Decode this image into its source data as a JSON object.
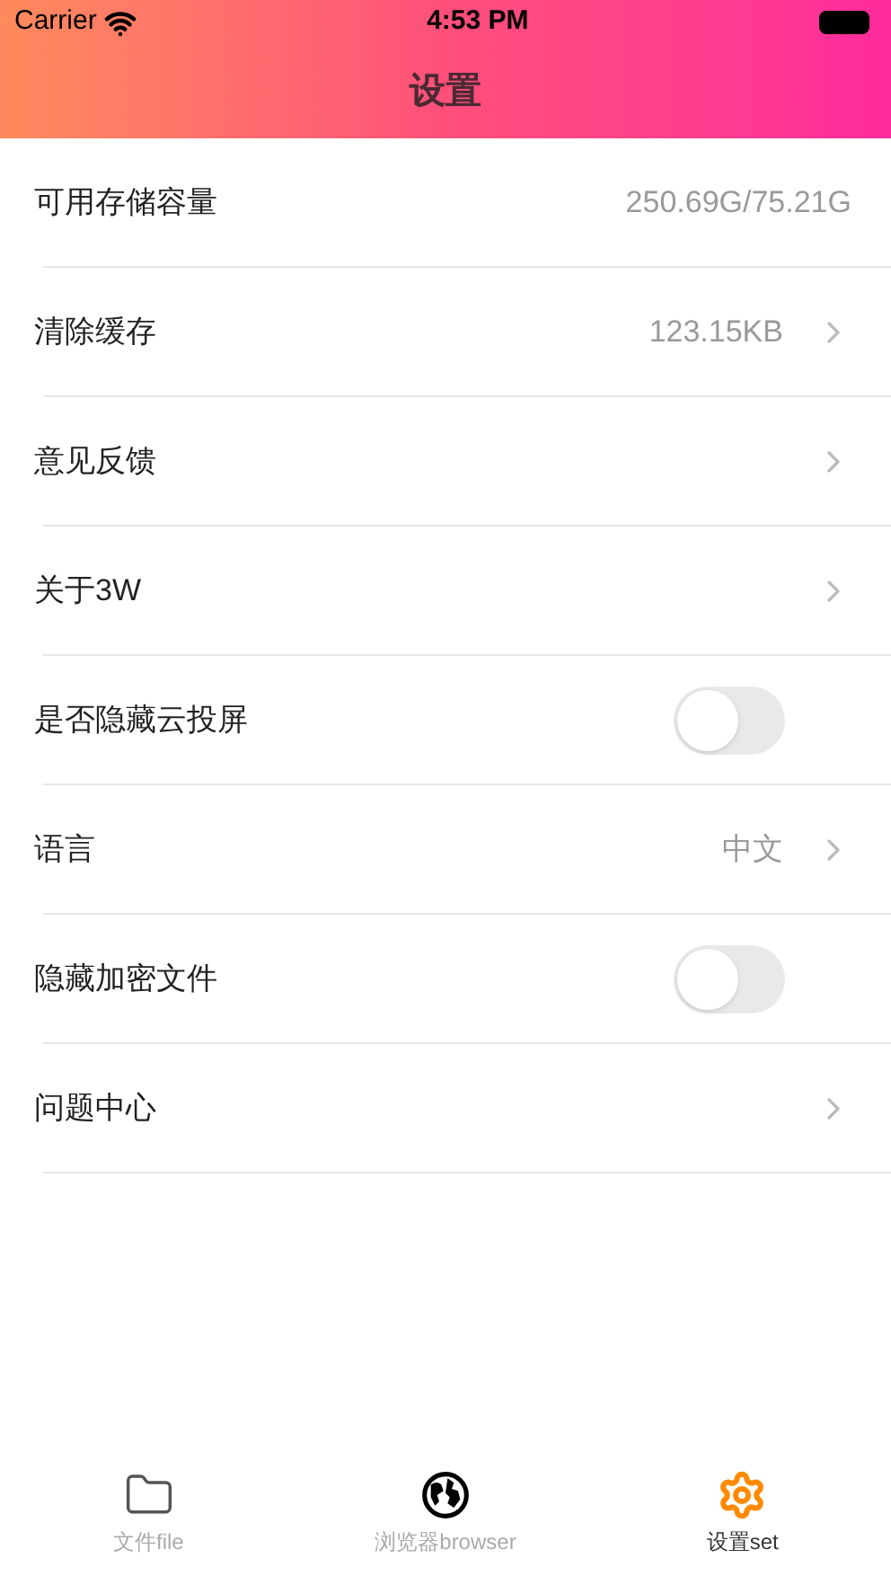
{
  "status_bar": {
    "carrier": "Carrier",
    "time": "4:53 PM"
  },
  "nav": {
    "title": "设置"
  },
  "rows": [
    {
      "kind": "value",
      "label": "可用存储容量",
      "value": "250.69G/75.21G"
    },
    {
      "kind": "link",
      "label": "清除缓存",
      "value": "123.15KB"
    },
    {
      "kind": "link",
      "label": "意见反馈"
    },
    {
      "kind": "link",
      "label": "关于3W"
    },
    {
      "kind": "toggle",
      "label": "是否隐藏云投屏",
      "on": false
    },
    {
      "kind": "link",
      "label": "语言",
      "value": "中文"
    },
    {
      "kind": "toggle",
      "label": "隐藏加密文件",
      "on": false
    },
    {
      "kind": "link",
      "label": "问题中心"
    }
  ],
  "tabs": [
    {
      "kind": "folder",
      "label": "文件file",
      "selected": false
    },
    {
      "kind": "globe",
      "label": "浏览器browser",
      "selected": false
    },
    {
      "kind": "gear",
      "label": "设置set",
      "selected": true
    }
  ]
}
